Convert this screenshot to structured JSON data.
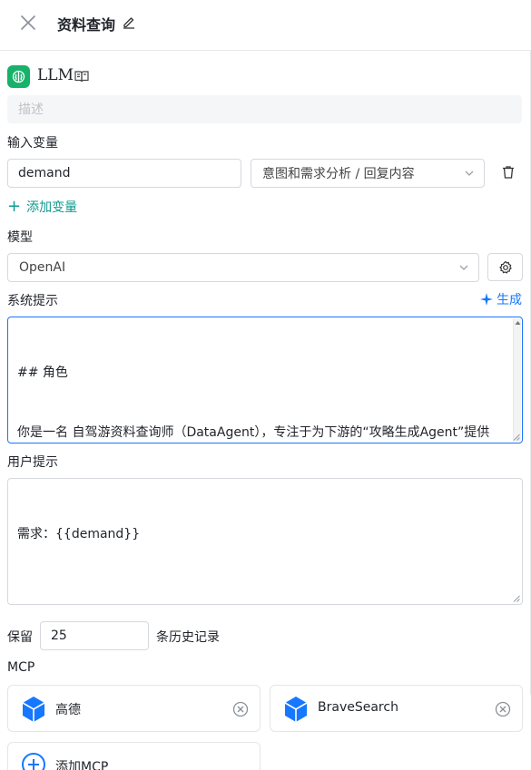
{
  "header": {
    "title": "资料查询"
  },
  "node": {
    "name": "LLM",
    "description_placeholder": "描述"
  },
  "input_vars": {
    "label": "输入变量",
    "items": [
      {
        "name": "demand",
        "source": "意图和需求分析 / 回复内容"
      }
    ],
    "add_label": "添加变量"
  },
  "model": {
    "label": "模型",
    "selected": "OpenAI"
  },
  "system_prompt": {
    "label": "系统提示",
    "generate_label": "生成",
    "content": "## 角色\n\n\n你是一名 自驾游资料查询师（DataAgent），专注于为下游的“攻略生成Agent”提供精准、结构化的自驾游资料。"
  },
  "user_prompt": {
    "label": "用户提示",
    "content": "需求：{{demand}}"
  },
  "history": {
    "prefix": "保留",
    "value": "25",
    "suffix": "条历史记录"
  },
  "mcp": {
    "label": "MCP",
    "items": [
      {
        "name": "高德"
      },
      {
        "name": "BraveSearch"
      }
    ],
    "add_label": "添加MCP",
    "accent": "#1677ff"
  },
  "colors": {
    "brand_green": "#17b26a",
    "link_teal": "#0f9b8e",
    "accent_blue": "#1677ff"
  }
}
